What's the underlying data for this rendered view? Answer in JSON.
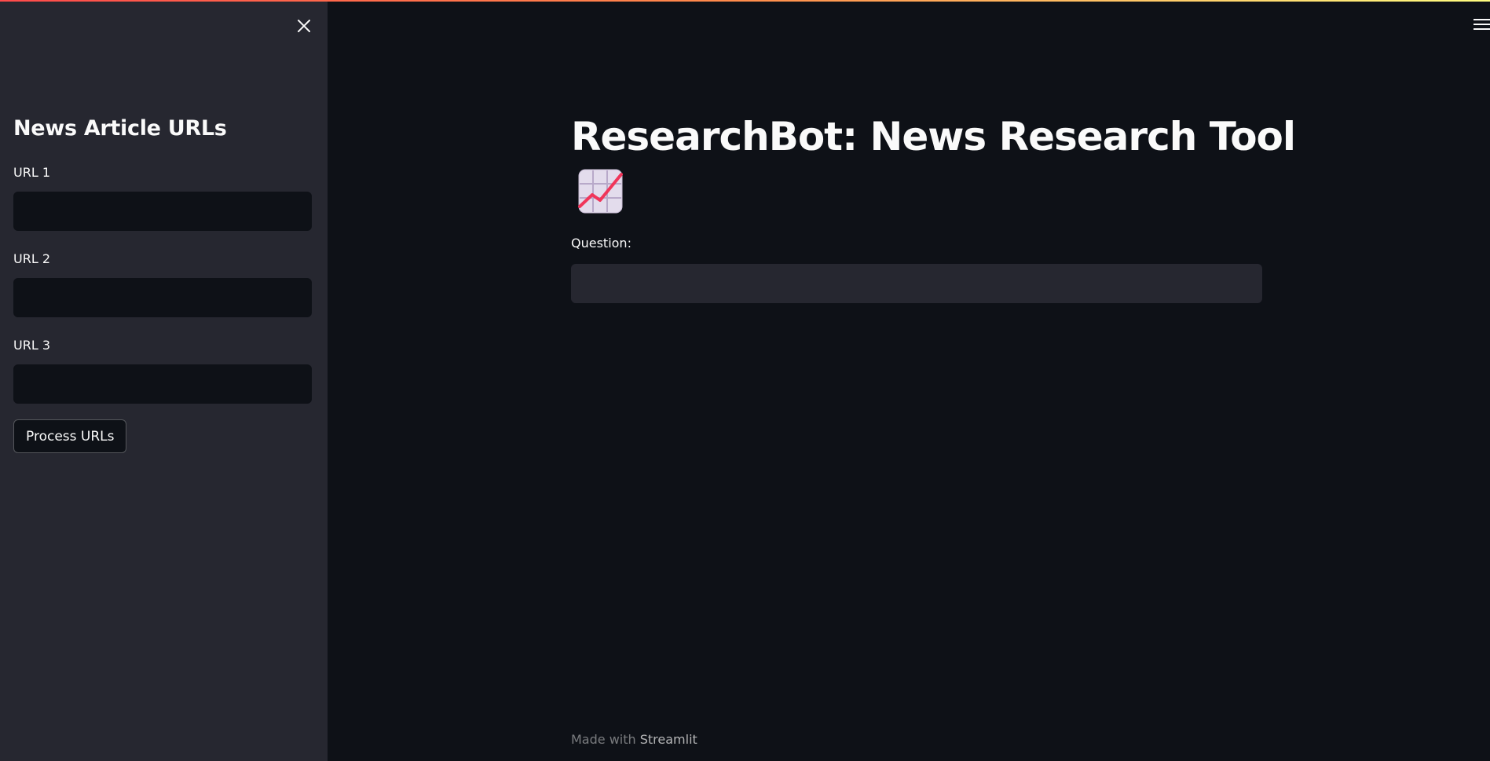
{
  "sidebar": {
    "title": "News Article URLs",
    "fields": [
      {
        "label": "URL 1",
        "value": ""
      },
      {
        "label": "URL 2",
        "value": ""
      },
      {
        "label": "URL 3",
        "value": ""
      }
    ],
    "button_label": "Process URLs"
  },
  "main": {
    "title": "ResearchBot: News Research Tool",
    "title_emoji_icon": "chart-increasing-icon",
    "question_label": "Question:",
    "question_value": ""
  },
  "footer": {
    "made_with": "Made with",
    "link": "Streamlit"
  },
  "colors": {
    "background": "#0e1117",
    "sidebar": "#262730",
    "text": "#fafafa",
    "accent": "#ff4b4b"
  }
}
